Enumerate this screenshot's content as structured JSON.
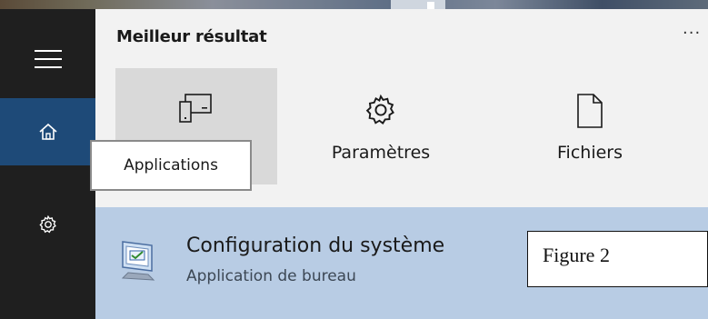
{
  "panel": {
    "section_title": "Meilleur résultat",
    "more_label": "···"
  },
  "rail": {
    "items": [
      {
        "icon": "hamburger-menu-icon"
      },
      {
        "icon": "home-icon"
      },
      {
        "icon": "gear-icon"
      }
    ]
  },
  "categories": [
    {
      "label": "Applications",
      "icon": "apps-device-icon"
    },
    {
      "label": "Paramètres",
      "icon": "gear-icon"
    },
    {
      "label": "Fichiers",
      "icon": "document-icon"
    }
  ],
  "tooltip": {
    "text": "Applications"
  },
  "result": {
    "title": "Configuration du système",
    "subtitle": "Application de bureau",
    "icon": "system-configuration-icon"
  },
  "figure_label": "Figure 2",
  "colors": {
    "rail_bg": "#1f1f1f",
    "rail_active": "#1e4a78",
    "panel_bg": "#f2f2f2",
    "selected_category": "#d9d9d9",
    "result_highlight": "#b8cce4"
  }
}
